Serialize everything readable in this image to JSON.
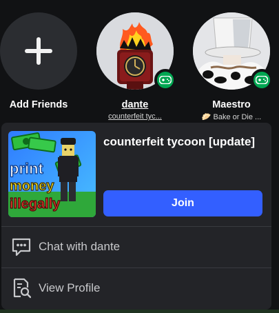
{
  "friends": [
    {
      "name": "Add Friends",
      "subtitle": ""
    },
    {
      "name": "dante",
      "subtitle": "counterfeit tyc..."
    },
    {
      "name": "Maestro",
      "subtitle": "🥟 Bake or Die ..."
    }
  ],
  "popup": {
    "game_title": "counterfeit tycoon [update]",
    "thumbnail_text": [
      "print",
      "money",
      "illegally"
    ],
    "join_label": "Join",
    "menu": [
      {
        "label": "Chat with dante",
        "icon": "chat-icon"
      },
      {
        "label": "View Profile",
        "icon": "view-profile-icon"
      }
    ]
  },
  "colors": {
    "background": "#111214",
    "card": "#232428",
    "join_button": "#335fff",
    "presence_badge": "#00a652",
    "divider": "#393b40",
    "menu_text": "#c8c9cc"
  },
  "icons": {
    "add": "plus-icon",
    "presence": "gamepad-icon"
  }
}
